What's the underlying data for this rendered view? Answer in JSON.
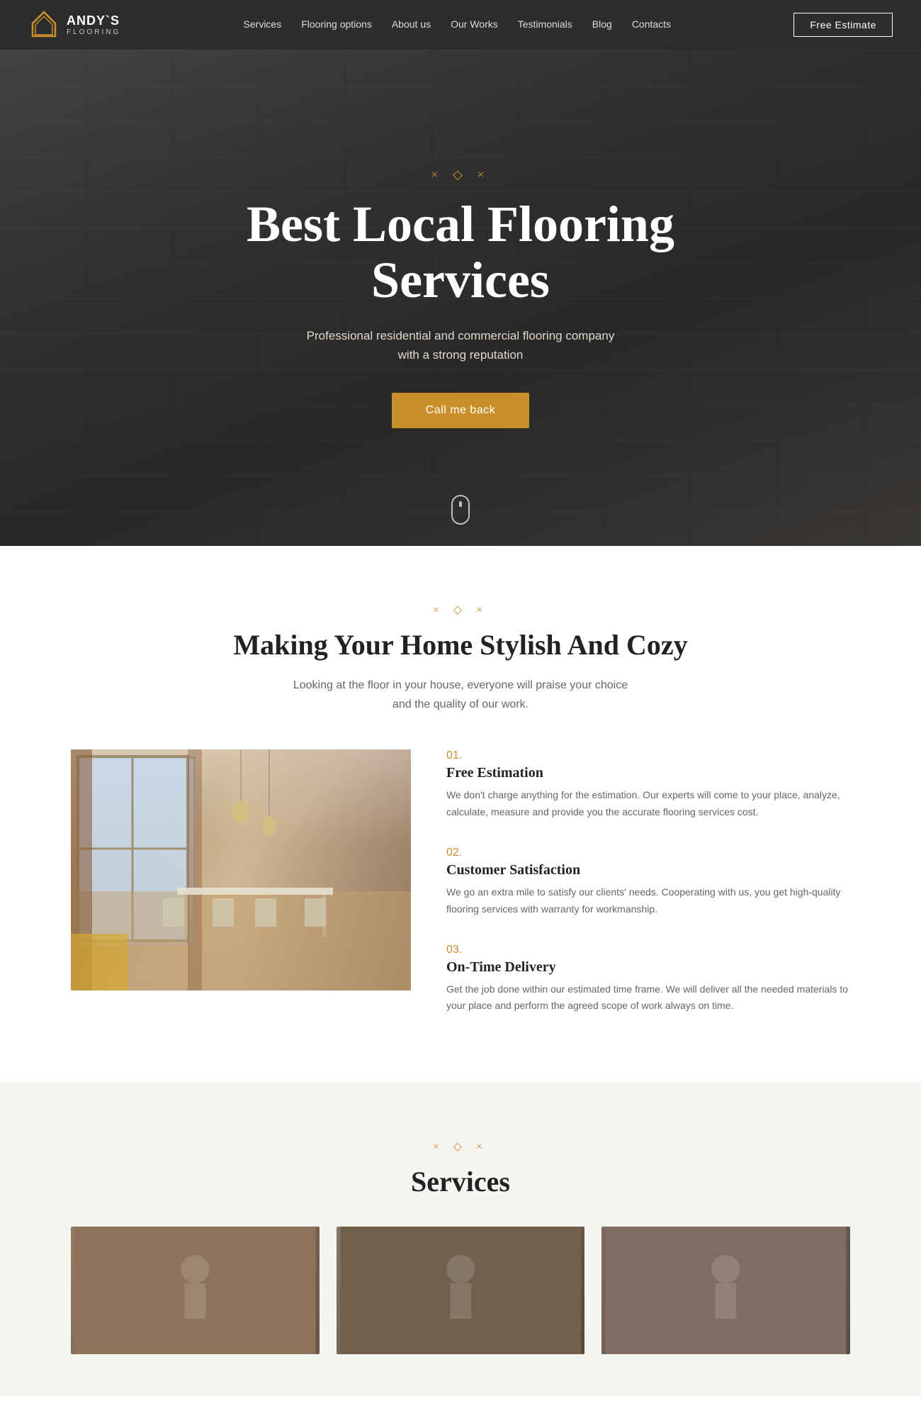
{
  "brand": {
    "name": "ANDY`S",
    "sub": "FLOORING",
    "logo_alt": "Andy's Flooring Logo"
  },
  "nav": {
    "links": [
      {
        "label": "Services",
        "href": "#"
      },
      {
        "label": "Flooring options",
        "href": "#"
      },
      {
        "label": "About us",
        "href": "#"
      },
      {
        "label": "Our Works",
        "href": "#"
      },
      {
        "label": "Testimonials",
        "href": "#"
      },
      {
        "label": "Blog",
        "href": "#"
      },
      {
        "label": "Contacts",
        "href": "#"
      }
    ],
    "cta_label": "Free Estimate"
  },
  "hero": {
    "ornament": "× ◇ ×",
    "title": "Best Local Flooring Services",
    "subtitle_line1": "Professional residential and commercial flooring company",
    "subtitle_line2": "with a strong reputation",
    "cta_label": "Call me back"
  },
  "making_home": {
    "ornament": "× ◇ ×",
    "title": "Making Your Home Stylish And Cozy",
    "desc_line1": "Looking at the floor in your house, everyone will praise your choice",
    "desc_line2": "and the quality of our work.",
    "features": [
      {
        "num": "01.",
        "title": "Free Estimation",
        "text": "We don't charge anything for the estimation. Our experts will come to your place, analyze, calculate, measure and provide you the accurate flooring services cost."
      },
      {
        "num": "02.",
        "title": "Customer Satisfaction",
        "text": "We go an extra mile to satisfy our clients' needs. Cooperating with us, you get high-quality flooring services with warranty for workmanship."
      },
      {
        "num": "03.",
        "title": "On-Time Delivery",
        "text": "Get the job done within our estimated time frame. We will deliver all the needed materials to your place and perform the agreed scope of work always on time."
      }
    ]
  },
  "services": {
    "ornament": "× ◇ ×",
    "title": "Services"
  },
  "colors": {
    "accent": "#c9902a",
    "dark": "#2c2c2c",
    "text": "#333",
    "muted": "#666"
  }
}
